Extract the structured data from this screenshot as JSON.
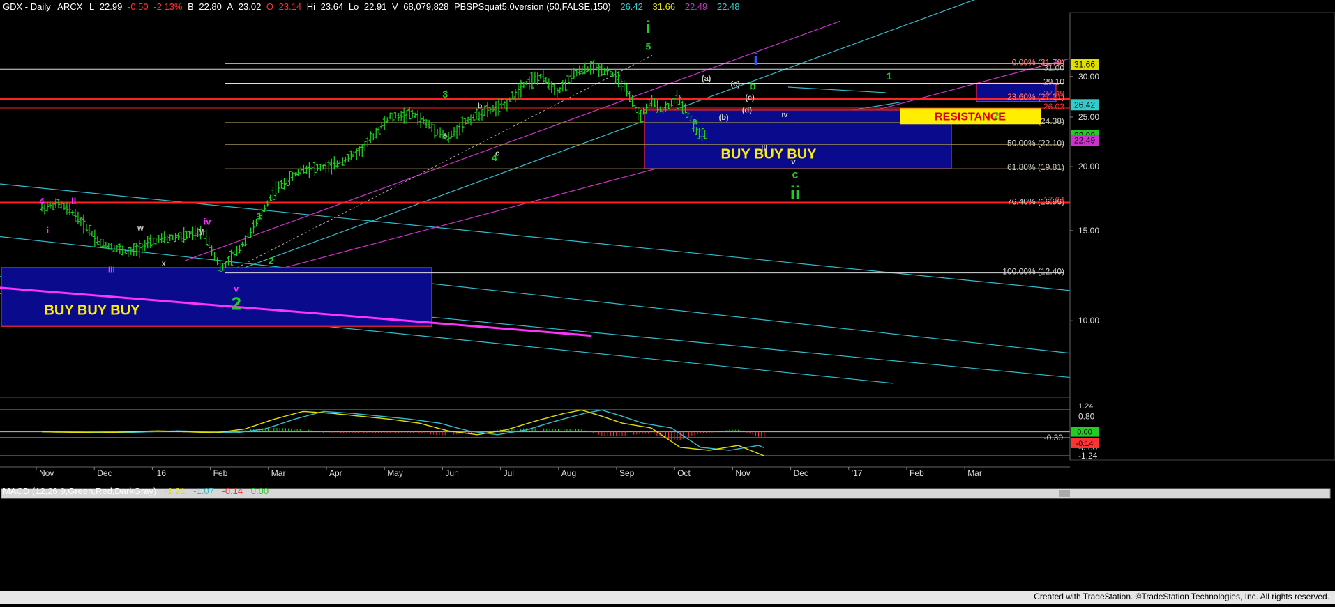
{
  "header": {
    "symbol": "GDX - Daily",
    "exchange": "ARCX",
    "last": "L=22.99",
    "change": "-0.50",
    "change_pct": "-2.13%",
    "bid": "B=22.80",
    "ask": "A=23.02",
    "open": "O=23.14",
    "high": "Hi=23.64",
    "low": "Lo=22.91",
    "volume": "V=68,079,828",
    "study": "PBSPSquat5.0version (50,FALSE,150)",
    "study_values": [
      "26.42",
      "31.66",
      "22.49",
      "22.48"
    ]
  },
  "macd_header": {
    "name": "MACD (12,26,9,Green,Red,DarkGray)",
    "values": [
      "-1.21",
      "-1.07",
      "-0.14",
      "0.00"
    ]
  },
  "footer": "Created with TradeStation. ©TradeStation Technologies, Inc. All rights reserved.",
  "colors": {
    "background": "#000000",
    "price_bars": "#22cc22",
    "wave_green": "#22cc22",
    "wave_magenta": "#ff33ff",
    "wave_blue": "#3355ff",
    "resistance_fill": "#ffee00",
    "resistance_text": "#dd0000",
    "buy_box_fill": "#0a0a8c",
    "buy_box_border": "#cc2233",
    "red_line": "#ff2222",
    "cyan_line": "#33bbcc",
    "purple_line": "#cc33cc"
  },
  "chart_data": {
    "type": "candlestick",
    "title": "GDX - Daily",
    "x_axis_labels": [
      "Nov",
      "Dec",
      "'16",
      "Feb",
      "Mar",
      "Apr",
      "May",
      "Jun",
      "Jul",
      "Aug",
      "Sep",
      "Oct",
      "Nov",
      "Dec",
      "'17",
      "Feb",
      "Mar"
    ],
    "y_scale": "log",
    "y_ticks": [
      10.0,
      15.0,
      20.0,
      25.0,
      30.0
    ],
    "ylim": [
      7.2,
      40.0
    ],
    "price_path": [
      {
        "t": 0.0,
        "v": 16.6
      },
      {
        "t": 0.3,
        "v": 16.9
      },
      {
        "t": 0.55,
        "v": 16.2
      },
      {
        "t": 1.0,
        "v": 14.2
      },
      {
        "t": 1.5,
        "v": 13.6
      },
      {
        "t": 2.0,
        "v": 14.4
      },
      {
        "t": 2.4,
        "v": 14.6
      },
      {
        "t": 2.8,
        "v": 14.9
      },
      {
        "t": 2.95,
        "v": 13.6
      },
      {
        "t": 3.1,
        "v": 12.6
      },
      {
        "t": 3.4,
        "v": 13.8
      },
      {
        "t": 3.7,
        "v": 15.5
      },
      {
        "t": 4.0,
        "v": 17.9
      },
      {
        "t": 4.5,
        "v": 19.8
      },
      {
        "t": 5.0,
        "v": 20.0
      },
      {
        "t": 5.5,
        "v": 21.5
      },
      {
        "t": 6.0,
        "v": 25.0
      },
      {
        "t": 6.4,
        "v": 25.3
      },
      {
        "t": 6.7,
        "v": 24.0
      },
      {
        "t": 7.0,
        "v": 22.7
      },
      {
        "t": 7.3,
        "v": 24.5
      },
      {
        "t": 7.6,
        "v": 25.5
      },
      {
        "t": 8.0,
        "v": 26.5
      },
      {
        "t": 8.3,
        "v": 29.0
      },
      {
        "t": 8.6,
        "v": 30.0
      },
      {
        "t": 8.9,
        "v": 28.0
      },
      {
        "t": 9.2,
        "v": 30.5
      },
      {
        "t": 9.5,
        "v": 31.3
      },
      {
        "t": 9.8,
        "v": 30.6
      },
      {
        "t": 10.0,
        "v": 29.0
      },
      {
        "t": 10.3,
        "v": 25.0
      },
      {
        "t": 10.5,
        "v": 26.8
      },
      {
        "t": 10.7,
        "v": 25.8
      },
      {
        "t": 10.95,
        "v": 27.2
      },
      {
        "t": 11.1,
        "v": 25.9
      },
      {
        "t": 11.3,
        "v": 23.2
      },
      {
        "t": 11.45,
        "v": 22.99
      }
    ],
    "horizontal_levels": [
      {
        "label": "0.00% (31.79)",
        "value": 31.79
      },
      {
        "label": "31.00",
        "value": 31.0
      },
      {
        "label": "29.10",
        "value": 29.1
      },
      {
        "label": "23.60% (27.21)",
        "value": 27.21
      },
      {
        "label": "27.49",
        "value": 27.49
      },
      {
        "label": "26.03",
        "value": 26.03
      },
      {
        "label": "38.20% (24.38)",
        "value": 24.38
      },
      {
        "label": "50.00% (22.10)",
        "value": 22.1
      },
      {
        "label": "61.80% (19.81)",
        "value": 19.81
      },
      {
        "label": "76.40% (16.96)",
        "value": 16.96
      },
      {
        "label": "17.04",
        "value": 17.04
      },
      {
        "label": "100.00% (12.40)",
        "value": 12.4
      }
    ],
    "price_badges": [
      {
        "label": "31.66",
        "value": 31.66,
        "color": "#e0e000"
      },
      {
        "label": "26.42",
        "value": 26.42,
        "color": "#33cccc"
      },
      {
        "label": "22.99",
        "value": 22.99,
        "color": "#22cc22"
      },
      {
        "label": "22.49",
        "value": 22.49,
        "color": "#cc33cc"
      }
    ],
    "annotations": {
      "buy_box_main": "BUY  BUY  BUY",
      "buy_box_left": "BUY BUY BUY",
      "resistance": "RESISTANCE"
    },
    "wave_labels": [
      {
        "t": 0.0,
        "v": 16.9,
        "text": "4",
        "color": "#ff33ff",
        "size": 13
      },
      {
        "t": 0.55,
        "v": 16.9,
        "text": "ii",
        "color": "#ff33ff",
        "size": 13
      },
      {
        "t": 0.1,
        "v": 14.8,
        "text": "i",
        "color": "#ff33ff",
        "size": 13
      },
      {
        "t": 1.2,
        "v": 12.4,
        "text": "iii",
        "color": "#ff33ff",
        "size": 12
      },
      {
        "t": 1.7,
        "v": 15.0,
        "text": "w",
        "color": "#cccccc",
        "size": 11
      },
      {
        "t": 2.1,
        "v": 12.8,
        "text": "x",
        "color": "#cccccc",
        "size": 11
      },
      {
        "t": 2.85,
        "v": 15.4,
        "text": "iv",
        "color": "#ff33ff",
        "size": 13
      },
      {
        "t": 2.75,
        "v": 14.8,
        "text": "y",
        "color": "#cccccc",
        "size": 11
      },
      {
        "t": 3.35,
        "v": 11.4,
        "text": "v",
        "color": "#ff33ff",
        "size": 12
      },
      {
        "t": 3.35,
        "v": 10.5,
        "text": "2",
        "color": "#22cc22",
        "size": 26
      },
      {
        "t": 3.75,
        "v": 15.8,
        "text": "1",
        "color": "#22cc22",
        "size": 14
      },
      {
        "t": 3.95,
        "v": 12.9,
        "text": "2",
        "color": "#22cc22",
        "size": 14
      },
      {
        "t": 6.95,
        "v": 27.3,
        "text": "3",
        "color": "#22cc22",
        "size": 14
      },
      {
        "t": 6.95,
        "v": 22.8,
        "text": "a",
        "color": "#cccccc",
        "size": 11
      },
      {
        "t": 7.55,
        "v": 26.0,
        "text": "b",
        "color": "#cccccc",
        "size": 11
      },
      {
        "t": 7.85,
        "v": 21.0,
        "text": "c",
        "color": "#cccccc",
        "size": 11
      },
      {
        "t": 7.8,
        "v": 20.5,
        "text": "4",
        "color": "#22cc22",
        "size": 14
      },
      {
        "t": 10.45,
        "v": 33.8,
        "text": "5",
        "color": "#22cc22",
        "size": 14
      },
      {
        "t": 10.45,
        "v": 36.5,
        "text": "i",
        "color": "#22cc22",
        "size": 24
      },
      {
        "t": 11.45,
        "v": 29.4,
        "text": "(a)",
        "color": "#cccccc",
        "size": 11
      },
      {
        "t": 11.95,
        "v": 28.7,
        "text": "(c)",
        "color": "#cccccc",
        "size": 11
      },
      {
        "t": 12.25,
        "v": 28.3,
        "text": "b",
        "color": "#22cc22",
        "size": 16
      },
      {
        "t": 12.2,
        "v": 27.0,
        "text": "(e)",
        "color": "#cccccc",
        "size": 11
      },
      {
        "t": 12.15,
        "v": 25.5,
        "text": "(d)",
        "color": "#cccccc",
        "size": 11
      },
      {
        "t": 11.75,
        "v": 24.7,
        "text": "(b)",
        "color": "#cccccc",
        "size": 11
      },
      {
        "t": 11.25,
        "v": 24.2,
        "text": "a",
        "color": "#22cc22",
        "size": 14
      },
      {
        "t": 12.8,
        "v": 25.0,
        "text": "iv",
        "color": "#cccccc",
        "size": 11
      },
      {
        "t": 12.45,
        "v": 21.5,
        "text": "iii",
        "color": "#cccccc",
        "size": 11
      },
      {
        "t": 12.95,
        "v": 20.2,
        "text": "v",
        "color": "#cccccc",
        "size": 11
      },
      {
        "t": 12.98,
        "v": 19.0,
        "text": "c",
        "color": "#22cc22",
        "size": 16
      },
      {
        "t": 12.98,
        "v": 17.3,
        "text": "ii",
        "color": "#22cc22",
        "size": 26
      },
      {
        "t": 12.3,
        "v": 31.6,
        "text": "i",
        "color": "#3355ff",
        "size": 24
      },
      {
        "t": 14.6,
        "v": 29.6,
        "text": "1",
        "color": "#22cc22",
        "size": 14
      },
      {
        "t": 16.45,
        "v": 24.8,
        "text": "2",
        "color": "#22cc22",
        "size": 14
      }
    ],
    "macd": {
      "ylim": [
        -1.45,
        1.35
      ],
      "y_ticks": [
        0.8,
        0.0,
        -0.8
      ],
      "level_labels": [
        "1.24",
        "-1.24",
        "-0.30"
      ],
      "badge_values": [
        "0.00",
        "-0.14"
      ],
      "macd_path": [
        {
          "t": 0.0,
          "v": 0.0
        },
        {
          "t": 1.0,
          "v": -0.05
        },
        {
          "t": 2.0,
          "v": 0.05
        },
        {
          "t": 3.0,
          "v": -0.05
        },
        {
          "t": 3.5,
          "v": 0.15
        },
        {
          "t": 4.0,
          "v": 0.65
        },
        {
          "t": 4.5,
          "v": 1.05
        },
        {
          "t": 5.0,
          "v": 0.95
        },
        {
          "t": 5.5,
          "v": 0.8
        },
        {
          "t": 6.0,
          "v": 0.65
        },
        {
          "t": 6.5,
          "v": 0.45
        },
        {
          "t": 7.0,
          "v": 0.05
        },
        {
          "t": 7.5,
          "v": -0.15
        },
        {
          "t": 8.0,
          "v": 0.1
        },
        {
          "t": 8.5,
          "v": 0.55
        },
        {
          "t": 9.0,
          "v": 0.95
        },
        {
          "t": 9.3,
          "v": 1.12
        },
        {
          "t": 9.6,
          "v": 0.85
        },
        {
          "t": 10.0,
          "v": 0.45
        },
        {
          "t": 10.5,
          "v": 0.2
        },
        {
          "t": 11.0,
          "v": -0.8
        },
        {
          "t": 11.5,
          "v": -0.95
        },
        {
          "t": 12.0,
          "v": -0.7
        },
        {
          "t": 12.5,
          "v": -1.3
        }
      ]
    }
  }
}
